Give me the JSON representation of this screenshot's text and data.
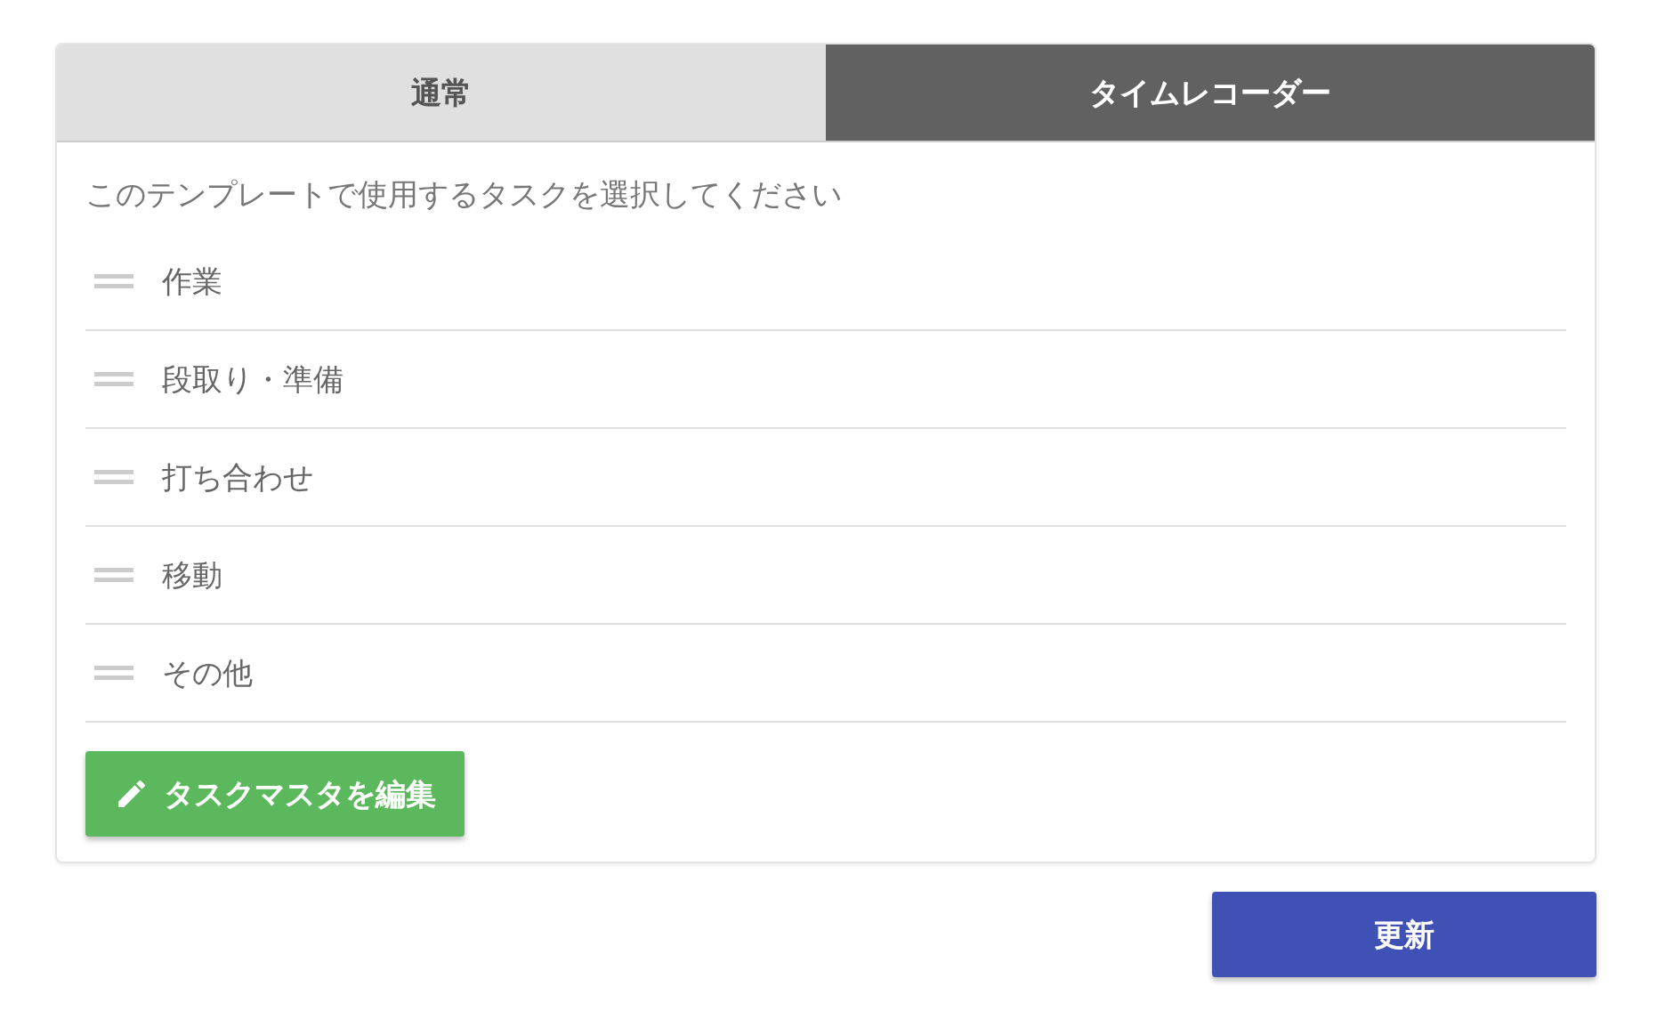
{
  "tabs": [
    {
      "label": "通常",
      "selected": false
    },
    {
      "label": "タイムレコーダー",
      "selected": true
    }
  ],
  "instruction": "このテンプレートで使用するタスクを選択してください",
  "tasks": [
    {
      "label": "作業"
    },
    {
      "label": "段取り・準備"
    },
    {
      "label": "打ち合わせ"
    },
    {
      "label": "移動"
    },
    {
      "label": "その他"
    }
  ],
  "edit_button": "タスクマスタを編集",
  "update_button": "更新"
}
